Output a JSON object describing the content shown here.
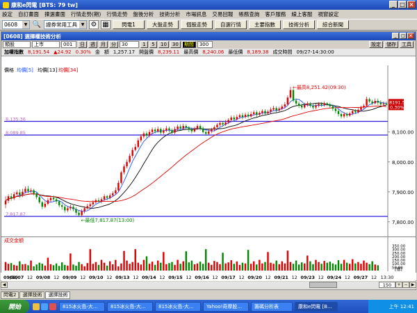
{
  "window": {
    "title": "康和e閃電 [BTS: 79 tw]",
    "buttons": [
      "_",
      "□",
      "×"
    ]
  },
  "menubar": [
    "設定",
    "自訂畫面",
    "揀選畫面",
    "行情走勢(期)",
    "行情走勢",
    "盤後分析",
    "技術分析",
    "市場訊息",
    "交易回報",
    "帳務查詢",
    "客戶服務",
    "線上客服",
    "視窗設定"
  ],
  "toolbar": {
    "symbol": "0608",
    "tool_combo": "證券常用工具",
    "buttons": [
      "閃電1",
      "大盤走勢",
      "個股走勢",
      "自選行情",
      "主要指數",
      "技術分析",
      "綜合新聞"
    ]
  },
  "chart_window": {
    "title": "[0608] 選擇權技術分析",
    "controls": {
      "type": "類股",
      "market": "上市",
      "code": "001",
      "periods": [
        "日",
        "週",
        "月",
        "分"
      ],
      "interval": "30",
      "steps": [
        "1",
        "5",
        "10",
        "30"
      ],
      "active_step": "期間",
      "count": "300",
      "right_buttons": [
        "設定",
        "儲存",
        "工具"
      ]
    },
    "info": {
      "name": "加權指數",
      "price": "8,191.54",
      "change": "▲24.92",
      "pct": "0.30%",
      "amount_label": "金",
      "amount_label2": "額",
      "amount": "1,257.17",
      "open_label": "開盤價",
      "open": "8,239.11",
      "high_label": "最高價",
      "high": "8,240.06",
      "low_label": "最低價",
      "low": "8,189.38",
      "time_label": "成交時間",
      "time": "09/27-14:30:00"
    },
    "price_panel": {
      "legend": [
        "價格",
        "均價[5]",
        "均價[13]",
        "均價[34]"
      ],
      "y_ticks": [
        "8,100.00",
        "8,000.00",
        "7,900.00",
        "7,800.00"
      ],
      "hlines": [
        "8,135.36",
        "8,089.85",
        "7,817.87"
      ],
      "high_annotation": "←最高8,251.42(09:30)",
      "low_annotation": "←最低7,817.87(13:00)",
      "last_price_tag": "8191.54",
      "last_pct_tag": "0.30%"
    },
    "volume_panel": {
      "label": "成交金額",
      "y_ticks": [
        "350.00",
        "300.00",
        "250.00",
        "200.00",
        "150.00",
        "100.00",
        "50.00"
      ],
      "unit": "[億]"
    },
    "date_axis": [
      "09/30",
      "09/07",
      "12",
      "09/08",
      "12",
      "09/09",
      "12",
      "09/10",
      "12",
      "09/13",
      "12",
      "09/14",
      "12",
      "09/15",
      "12",
      "09/16",
      "12",
      "09/17",
      "12",
      "09/20",
      "12",
      "09/21",
      "12",
      "09/23",
      "12",
      "09/24",
      "12",
      "09/27",
      "12",
      "13:30"
    ],
    "scroll_value": "150"
  },
  "subtabs": [
    "閃電2",
    "選擇技術",
    "選擇技術"
  ],
  "taskbar": {
    "start": "開始",
    "items": [
      "815冰火島-大...",
      "815冰火島-大...",
      "815冰火島-大...",
      "Yahoo!奇摩股...",
      "籌碼分析表",
      "康和e閃電 [B..."
    ],
    "clock": "上午 12:41"
  },
  "colors": {
    "up": "#e00000",
    "down": "#008800",
    "ma5": "#2050ff",
    "ma13": "#000000",
    "ma34": "#e00000",
    "hline": "#2a1ad8"
  },
  "chart_data": {
    "type": "line",
    "title": "加權指數",
    "ylabel": "",
    "ylim": [
      7760,
      8290
    ],
    "hlines": [
      8135.36,
      8089.85,
      7817.87
    ],
    "candles": [
      [
        7858,
        7870,
        7845,
        7885
      ],
      [
        7870,
        7885,
        7862,
        7892
      ],
      [
        7885,
        7878,
        7870,
        7895
      ],
      [
        7878,
        7892,
        7872,
        7900
      ],
      [
        7892,
        7898,
        7885,
        7905
      ],
      [
        7898,
        7890,
        7880,
        7908
      ],
      [
        7890,
        7900,
        7882,
        7910
      ],
      [
        7900,
        7910,
        7895,
        7918
      ],
      [
        7910,
        7902,
        7895,
        7920
      ],
      [
        7902,
        7905,
        7895,
        7912
      ],
      [
        7905,
        7895,
        7888,
        7910
      ],
      [
        7895,
        7882,
        7875,
        7900
      ],
      [
        7882,
        7865,
        7860,
        7888
      ],
      [
        7865,
        7850,
        7842,
        7870
      ],
      [
        7850,
        7860,
        7845,
        7868
      ],
      [
        7860,
        7872,
        7855,
        7880
      ],
      [
        7872,
        7880,
        7865,
        7886
      ],
      [
        7880,
        7875,
        7868,
        7888
      ],
      [
        7875,
        7868,
        7860,
        7882
      ],
      [
        7868,
        7855,
        7848,
        7872
      ],
      [
        7855,
        7850,
        7840,
        7862
      ],
      [
        7850,
        7838,
        7830,
        7855
      ],
      [
        7838,
        7845,
        7832,
        7852
      ],
      [
        7845,
        7850,
        7838,
        7858
      ],
      [
        7850,
        7842,
        7835,
        7856
      ],
      [
        7842,
        7830,
        7822,
        7848
      ],
      [
        7830,
        7822,
        7818,
        7838
      ],
      [
        7822,
        7835,
        7818,
        7842
      ],
      [
        7835,
        7845,
        7828,
        7852
      ],
      [
        7845,
        7852,
        7840,
        7860
      ],
      [
        7852,
        7858,
        7845,
        7865
      ],
      [
        7858,
        7865,
        7850,
        7872
      ],
      [
        7865,
        7872,
        7860,
        7878
      ],
      [
        7872,
        7868,
        7862,
        7880
      ],
      [
        7868,
        7875,
        7862,
        7882
      ],
      [
        7875,
        7885,
        7870,
        7892
      ],
      [
        7885,
        7880,
        7872,
        7890
      ],
      [
        7880,
        7888,
        7875,
        7895
      ],
      [
        7888,
        7895,
        7882,
        7902
      ],
      [
        7895,
        7905,
        7890,
        7915
      ],
      [
        7905,
        7930,
        7900,
        7938
      ],
      [
        7930,
        7965,
        7925,
        7970
      ],
      [
        7965,
        7985,
        7958,
        7992
      ],
      [
        7985,
        8000,
        7978,
        8008
      ],
      [
        8000,
        8020,
        7995,
        8028
      ],
      [
        8020,
        8040,
        8012,
        8048
      ],
      [
        8040,
        8050,
        8035,
        8060
      ],
      [
        8050,
        8072,
        8045,
        8080
      ],
      [
        8072,
        8085,
        8065,
        8092
      ],
      [
        8085,
        8095,
        8078,
        8102
      ],
      [
        8095,
        8088,
        8080,
        8102
      ],
      [
        8088,
        8100,
        8082,
        8108
      ],
      [
        8100,
        8108,
        8092,
        8115
      ],
      [
        8108,
        8102,
        8095,
        8115
      ],
      [
        8102,
        8110,
        8098,
        8118
      ],
      [
        8110,
        8098,
        8090,
        8115
      ],
      [
        8098,
        8105,
        8092,
        8112
      ],
      [
        8105,
        8112,
        8100,
        8120
      ],
      [
        8112,
        8106,
        8098,
        8118
      ],
      [
        8106,
        8098,
        8090,
        8112
      ],
      [
        8098,
        8110,
        8092,
        8118
      ],
      [
        8110,
        8118,
        8105,
        8125
      ],
      [
        8118,
        8112,
        8105,
        8125
      ],
      [
        8112,
        8120,
        8108,
        8128
      ],
      [
        8120,
        8115,
        8108,
        8126
      ],
      [
        8115,
        8108,
        8100,
        8120
      ],
      [
        8108,
        8102,
        8095,
        8115
      ],
      [
        8102,
        8112,
        8098,
        8118
      ],
      [
        8112,
        8120,
        8106,
        8126
      ],
      [
        8120,
        8112,
        8105,
        8126
      ],
      [
        8112,
        8100,
        8095,
        8118
      ],
      [
        8100,
        8094,
        8088,
        8106
      ],
      [
        8094,
        8102,
        8090,
        8110
      ],
      [
        8102,
        8108,
        8096,
        8114
      ],
      [
        8108,
        8116,
        8102,
        8122
      ],
      [
        8116,
        8124,
        8110,
        8130
      ],
      [
        8124,
        8130,
        8118,
        8138
      ],
      [
        8130,
        8125,
        8118,
        8136
      ],
      [
        8125,
        8132,
        8120,
        8140
      ],
      [
        8132,
        8140,
        8126,
        8146
      ],
      [
        8140,
        8148,
        8132,
        8155
      ],
      [
        8148,
        8142,
        8135,
        8155
      ],
      [
        8142,
        8150,
        8138,
        8158
      ],
      [
        8150,
        8156,
        8144,
        8162
      ],
      [
        8156,
        8150,
        8142,
        8164
      ],
      [
        8150,
        8158,
        8145,
        8165
      ],
      [
        8158,
        8152,
        8146,
        8166
      ],
      [
        8152,
        8160,
        8148,
        8168
      ],
      [
        8160,
        8166,
        8154,
        8172
      ],
      [
        8166,
        8158,
        8150,
        8172
      ],
      [
        8158,
        8164,
        8152,
        8170
      ],
      [
        8164,
        8170,
        8158,
        8176
      ],
      [
        8170,
        8162,
        8156,
        8176
      ],
      [
        8162,
        8168,
        8158,
        8174
      ],
      [
        8168,
        8175,
        8162,
        8182
      ],
      [
        8175,
        8180,
        8170,
        8188
      ],
      [
        8180,
        8172,
        8165,
        8186
      ],
      [
        8172,
        8178,
        8168,
        8184
      ],
      [
        8178,
        8185,
        8172,
        8192
      ],
      [
        8185,
        8192,
        8178,
        8200
      ],
      [
        8192,
        8215,
        8188,
        8222
      ],
      [
        8215,
        8240,
        8210,
        8251
      ],
      [
        8240,
        8205,
        8200,
        8245
      ],
      [
        8205,
        8195,
        8188,
        8212
      ],
      [
        8195,
        8188,
        8180,
        8202
      ],
      [
        8188,
        8182,
        8175,
        8195
      ],
      [
        8182,
        8190,
        8178,
        8198
      ],
      [
        8190,
        8195,
        8184,
        8202
      ],
      [
        8195,
        8188,
        8182,
        8200
      ],
      [
        8188,
        8182,
        8175,
        8195
      ],
      [
        8182,
        8188,
        8176,
        8195
      ],
      [
        8188,
        8194,
        8182,
        8200
      ],
      [
        8194,
        8190,
        8184,
        8200
      ],
      [
        8190,
        8196,
        8185,
        8202
      ],
      [
        8196,
        8192,
        8186,
        8200
      ],
      [
        8192,
        8186,
        8180,
        8198
      ],
      [
        8186,
        8178,
        8170,
        8192
      ],
      [
        8178,
        8170,
        8162,
        8184
      ],
      [
        8170,
        8160,
        8152,
        8176
      ],
      [
        8160,
        8152,
        8145,
        8166
      ],
      [
        8152,
        8160,
        8146,
        8166
      ],
      [
        8160,
        8155,
        8148,
        8166
      ],
      [
        8155,
        8162,
        8150,
        8168
      ],
      [
        8162,
        8170,
        8156,
        8176
      ],
      [
        8170,
        8166,
        8160,
        8176
      ],
      [
        8166,
        8174,
        8162,
        8180
      ],
      [
        8174,
        8182,
        8168,
        8188
      ],
      [
        8182,
        8188,
        8176,
        8194
      ],
      [
        8188,
        8210,
        8184,
        8218
      ],
      [
        8210,
        8202,
        8196,
        8215
      ],
      [
        8202,
        8196,
        8190,
        8208
      ],
      [
        8196,
        8204,
        8192,
        8212
      ],
      [
        8204,
        8198,
        8190,
        8212
      ],
      [
        8198,
        8192,
        8186,
        8206
      ],
      [
        8192,
        8195,
        8186,
        8202
      ],
      [
        8195,
        8191.54,
        8189,
        8202
      ]
    ],
    "volume": [
      120,
      95,
      105,
      80,
      70,
      130,
      88,
      92,
      75,
      140,
      60,
      85,
      110,
      96,
      70,
      180,
      90,
      75,
      100,
      65,
      115,
      80,
      70,
      240,
      85,
      68,
      120,
      90,
      60,
      105,
      300,
      95,
      120,
      80,
      150,
      110,
      70,
      130,
      88,
      150,
      60,
      100,
      275,
      140,
      95,
      120,
      300,
      110,
      85,
      150,
      200,
      95,
      125,
      80,
      140,
      110,
      260,
      90,
      105,
      120,
      80,
      150,
      95,
      130,
      270,
      115,
      140,
      88,
      100,
      125,
      95,
      300,
      110,
      80,
      135,
      120,
      90,
      250,
      100,
      115,
      145,
      95,
      128,
      80,
      110,
      100,
      290,
      95,
      130,
      85,
      150,
      100,
      120,
      260,
      110,
      95,
      140,
      90,
      130,
      100,
      280,
      120,
      95,
      140,
      85,
      115,
      100,
      210,
      130,
      90,
      150,
      120,
      95,
      135,
      110,
      125,
      100,
      85,
      145,
      95,
      150,
      110,
      95,
      160,
      100,
      120,
      95,
      140,
      110,
      90,
      130,
      85,
      75
    ],
    "volume_ylim": [
      0,
      380
    ]
  }
}
